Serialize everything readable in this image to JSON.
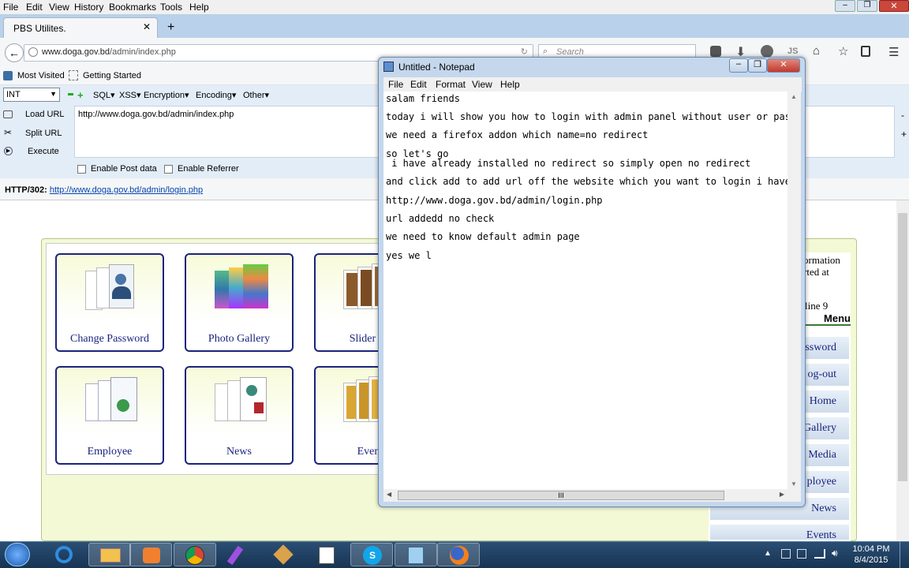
{
  "menubar": {
    "items": [
      "File",
      "Edit",
      "View",
      "History",
      "Bookmarks",
      "Tools",
      "Help"
    ]
  },
  "tab": {
    "title": "PBS Utilites."
  },
  "urlbar": {
    "domain": "www.doga.gov.bd",
    "path": "/admin/index.php"
  },
  "search": {
    "placeholder": "Search"
  },
  "nav_icons": [
    "back-icon",
    "pocket-icon",
    "download-icon",
    "sync-icon",
    "js-icon",
    "home-icon",
    "bookmark-star-icon",
    "reader-icon",
    "menu-icon"
  ],
  "bookmarks": [
    "Most Visited",
    "Getting Started"
  ],
  "hackbar": {
    "select": "INT",
    "menus": [
      "SQL▾",
      "XSS▾",
      "Encryption▾",
      "Encoding▾",
      "Other▾"
    ],
    "actions": [
      "Load URL",
      "Split URL",
      "Execute"
    ],
    "url_value": "http://www.doga.gov.bd/admin/index.php",
    "checkboxes": [
      "Enable Post data",
      "Enable Referrer"
    ]
  },
  "status": {
    "label": "HTTP/302:",
    "link": "http://www.doga.gov.bd/admin/login.php"
  },
  "admin": {
    "tiles": [
      "Change Password",
      "Photo Gallery",
      "Slider In",
      "Employee",
      "News",
      "Even"
    ],
    "side_text": [
      "ormation",
      "rted at",
      "line 9"
    ],
    "menu_title": "Menu",
    "menu_links": [
      "ssword",
      "og-out",
      "Home",
      "Gallery",
      "Media",
      "ployee",
      "News",
      "Events"
    ]
  },
  "notepad": {
    "title": "Untitled - Notepad",
    "menu": [
      "File",
      "Edit",
      "Format",
      "View",
      "Help"
    ],
    "lines": [
      "salam friends",
      "today i will show you how to login with admin panel without user or pas",
      "we need a firefox addon which name=no redirect",
      "so let's go",
      " i have already installed no redirect so simply open no redirect",
      "and click add to add url off the website which you want to login i have",
      "http://www.doga.gov.bd/admin/login.php",
      "url addedd no check",
      "we need to know default admin page",
      "yes we l"
    ],
    "hscroll_grip": "III"
  },
  "taskbar": {
    "apps": [
      "start-orb-icon",
      "ie-icon",
      "explorer-icon",
      "media-player-icon",
      "chrome-icon",
      "feather-app-icon",
      "tool-app-icon",
      "notes-app-icon",
      "skype-icon",
      "notepad-icon",
      "firefox-icon"
    ],
    "time": "10:04 PM",
    "date": "8/4/2015"
  },
  "colors": {
    "taskbar": "#1f3f63",
    "firefox_chrome": "#b9d1ea",
    "link": "#0645ad",
    "tile_border": "#1a237e"
  }
}
